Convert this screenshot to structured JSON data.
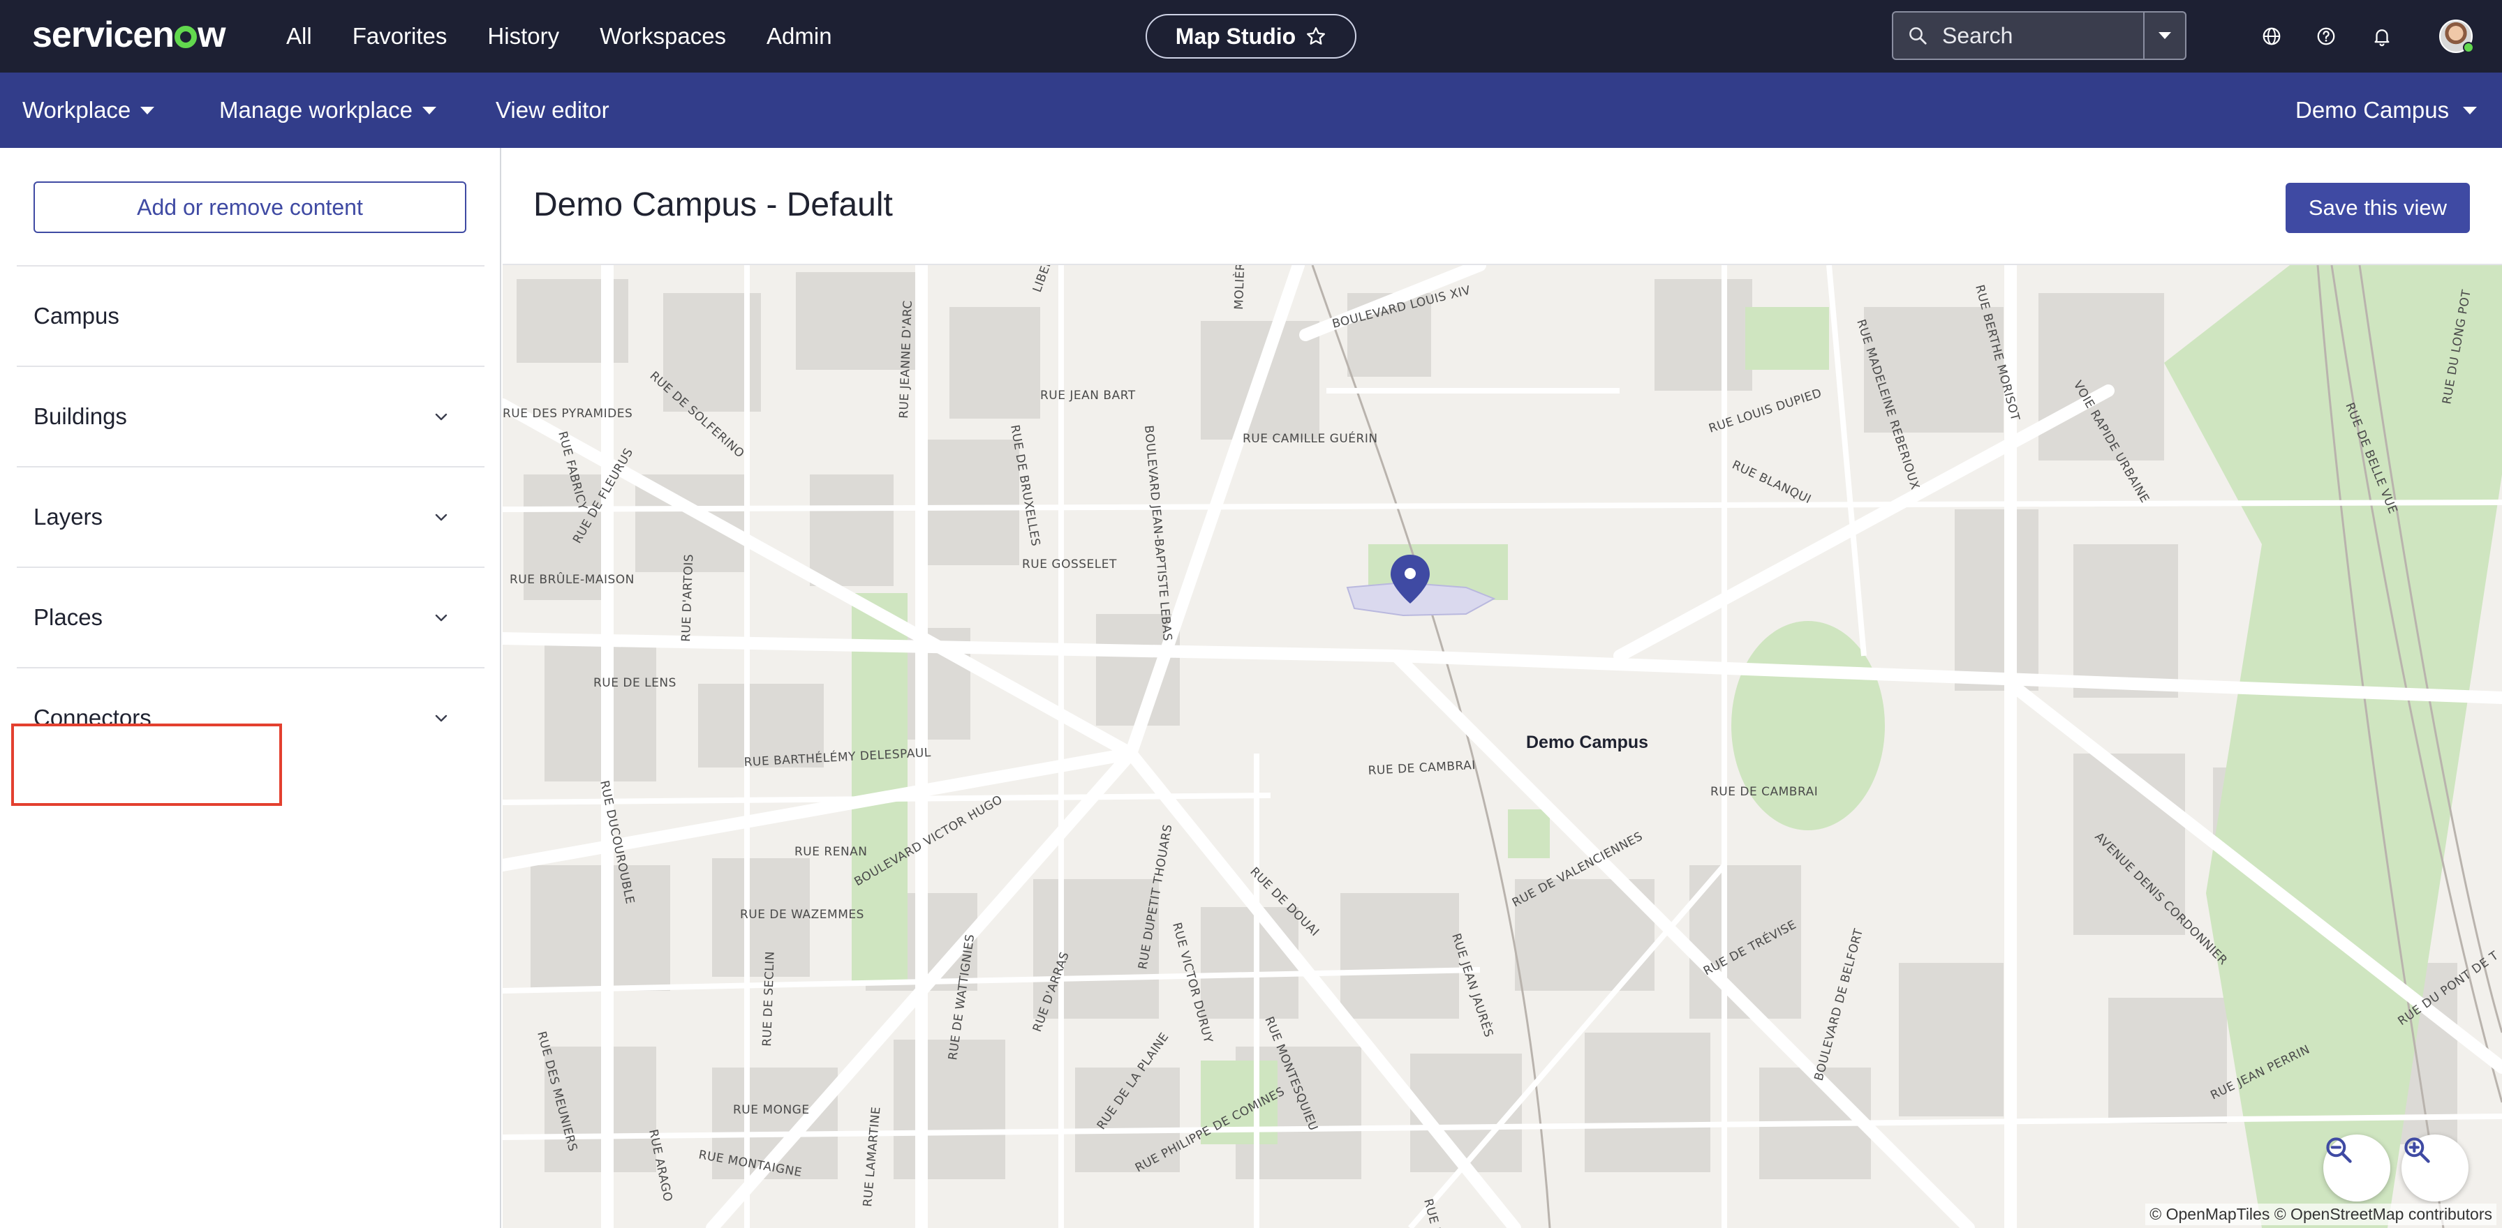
{
  "topnav": {
    "logo": "servicenow",
    "links": [
      "All",
      "Favorites",
      "History",
      "Workspaces",
      "Admin"
    ],
    "studio_label": "Map Studio",
    "search_placeholder": "Search"
  },
  "subnav": {
    "workplace": "Workplace",
    "manage_workplace": "Manage workplace",
    "view_editor": "View editor",
    "campus_selector": "Demo Campus"
  },
  "leftpanel": {
    "add_button": "Add or remove content",
    "items": [
      {
        "label": "Campus",
        "expandable": false
      },
      {
        "label": "Buildings",
        "expandable": true
      },
      {
        "label": "Layers",
        "expandable": true
      },
      {
        "label": "Places",
        "expandable": true
      },
      {
        "label": "Connectors",
        "expandable": true
      }
    ]
  },
  "main": {
    "title": "Demo Campus - Default",
    "save_button": "Save this view"
  },
  "map": {
    "pin_label": "Demo Campus",
    "attribution": "© OpenMapTiles © OpenStreetMap contributors",
    "streets": [
      "RUE DES PYRAMIDES",
      "RUE DE SOLFERINO",
      "RUE JEANNE D'ARC",
      "RUE JEAN BART",
      "RUE CAMILLE GUÉRIN",
      "BOULEVARD LOUIS XIV",
      "RUE LOUIS DUPIED",
      "RUE BLANQUI",
      "RUE MADELEINE REBERIOUX",
      "RUE BERTHE MORISOT",
      "VOIE RAPIDE URBAINE",
      "RUE DE BELLE VUE",
      "RUE DU LONG POT",
      "RUE FABRICY",
      "RUE DE FLEURUS",
      "RUE BRÛLE-MAISON",
      "RUE D'ARTOIS",
      "RUE DE BRUXELLES",
      "BOULEVARD JEAN-BAPTISTE LEBAS",
      "RUE GOSSELET",
      "RUE DE LENS",
      "RUE BARTHÉLÉMY DELESPAUL",
      "RUE DE CAMBRAI",
      "RUE RENAN",
      "BOULEVARD VICTOR HUGO",
      "RUE DUPETIT THOUARS",
      "RUE DE DOUAI",
      "RUE DE VALENCIENNES",
      "RUE DE TRÉVISE",
      "BOULEVARD DE BELFORT",
      "AVENUE DENIS CORDONNIER",
      "RUE DE WAZEMMES",
      "RUE VICTOR DURUY",
      "RUE JEAN JAURÈS",
      "RUE DE SECLIN",
      "RUE DE WATTIGNIES",
      "RUE D'ARRAS",
      "RUE MONTESQUIEU",
      "RUE DE LA PLAINE",
      "RUE MONGE",
      "RUE LAMARTINE",
      "RUE PHILIPPE DE COMINES",
      "RUE DES MEUNIERS",
      "RUE ARAGO",
      "RUE MONTAIGNE",
      "RUE JEAN PERRIN",
      "RUE DU PONT DE T",
      "RUE DUCOUROUBLE",
      "LIBERTÉ",
      "MOLIÈRE",
      "RUE DE DOUAI"
    ]
  },
  "colors": {
    "topnav_bg": "#1d2033",
    "subnav_bg": "#323d8a",
    "accent": "#3f4aa3",
    "highlight": "#e3402f",
    "map_bg": "#f2f0ec",
    "park": "#cfe5c0",
    "pin": "#3f4aa3"
  },
  "icons": {
    "search": "search-icon",
    "dropdown": "chevron-down-icon",
    "globe": "globe-icon",
    "help": "help-icon",
    "bell": "bell-icon",
    "star": "star-icon",
    "pin": "map-pin-icon",
    "zoom_out": "zoom-out-icon",
    "zoom_in": "zoom-in-icon"
  }
}
